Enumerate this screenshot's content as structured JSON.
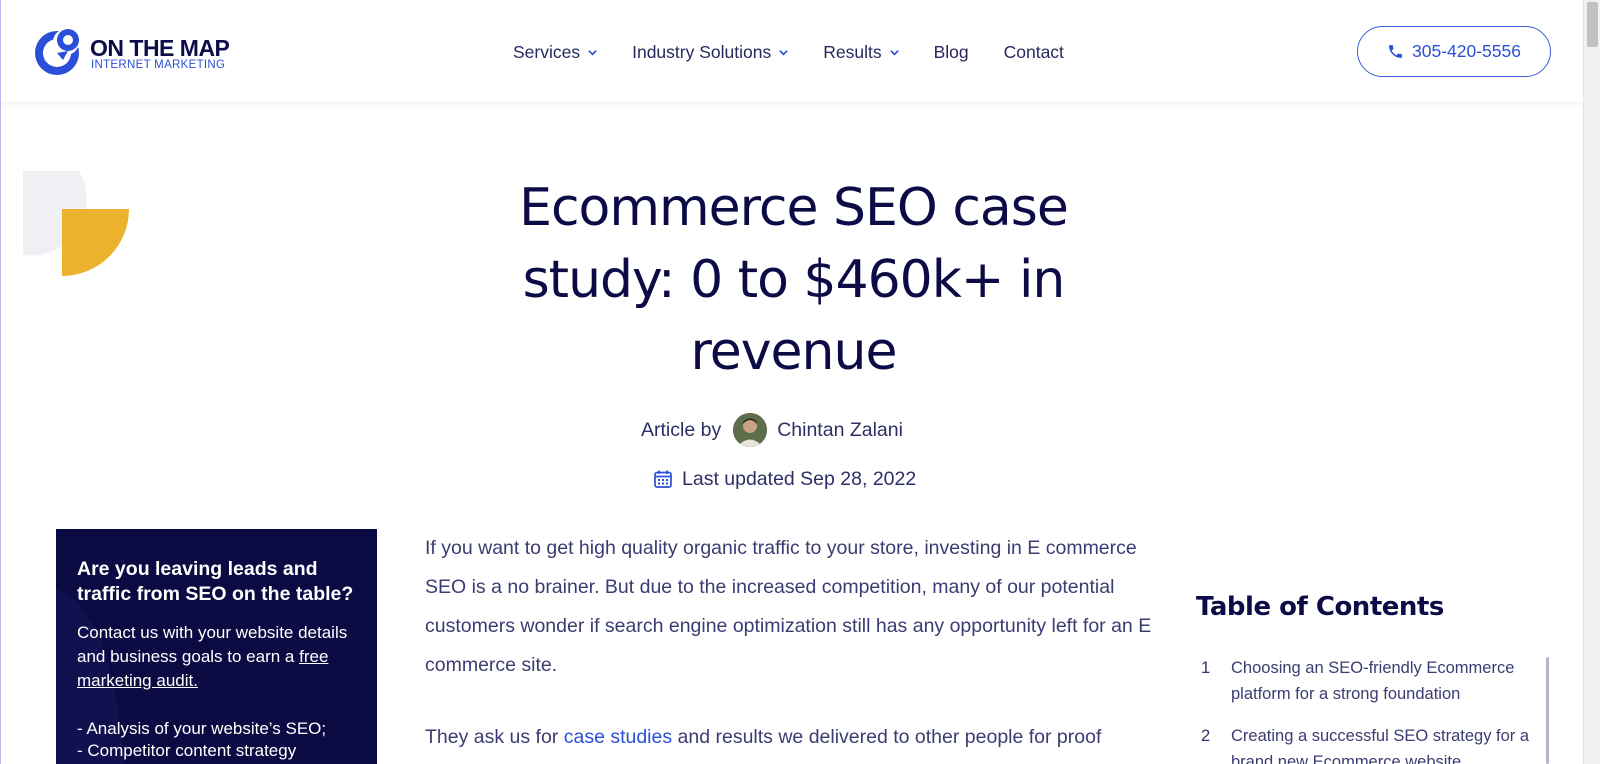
{
  "header": {
    "logo": {
      "title": "ON THE MAP",
      "subtitle": "INTERNET MARKETING"
    },
    "nav": [
      {
        "label": "Services",
        "dropdown": true
      },
      {
        "label": "Industry Solutions",
        "dropdown": true
      },
      {
        "label": "Results",
        "dropdown": true
      },
      {
        "label": "Blog",
        "dropdown": false
      },
      {
        "label": "Contact",
        "dropdown": false
      }
    ],
    "phone": "305-420-5556"
  },
  "article": {
    "title": "Ecommerce SEO case study: 0 to $460k+ in revenue",
    "byline_prefix": "Article by",
    "author": "Chintan Zalani",
    "updated": "Last updated Sep 28, 2022",
    "para1": "If you want to get high quality organic traffic to your store, investing in E commerce SEO is a no brainer. But due to the increased competition, many of our potential customers wonder if search engine optimization still has any opportunity left for an E commerce site.",
    "para2_before": "They ask us for ",
    "para2_link": "case studies",
    "para2_after": " and results we delivered to other people for proof"
  },
  "cta": {
    "heading": "Are you leaving leads and traffic from SEO on the table?",
    "text_before": "Contact us with your website details and business goals to earn a ",
    "link": "free marketing audit.",
    "items": [
      "- Analysis of your website’s SEO;",
      "- Competitor content strategy"
    ]
  },
  "toc": {
    "title": "Table of Contents",
    "items": [
      {
        "num": "1",
        "label": "Choosing an SEO-friendly Ecommerce platform for a strong foundation"
      },
      {
        "num": "2",
        "label": "Creating a successful SEO strategy for a brand new Ecommerce website"
      }
    ]
  },
  "colors": {
    "navy": "#0b0a43",
    "accent_blue": "#2b4fd8",
    "gold": "#ecb22e",
    "pale_gray": "#eef0f4"
  }
}
